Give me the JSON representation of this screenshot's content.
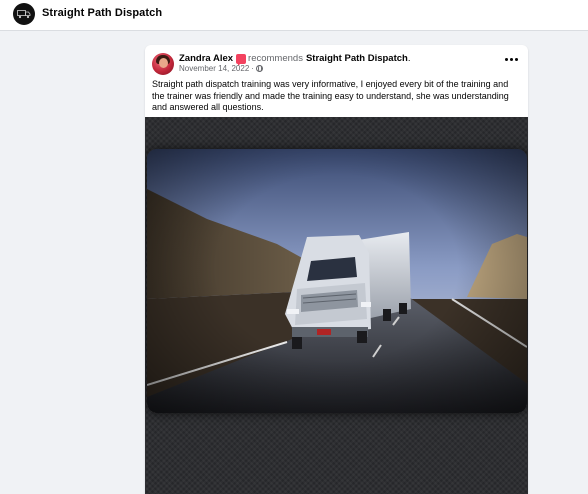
{
  "header": {
    "page_name": "Straight Path Dispatch",
    "logo_icon": "truck-logo-icon"
  },
  "post": {
    "author": "Zandra Alex",
    "recommend_icon": "recommend-flag-icon",
    "recommend_verb": "recommends",
    "recommended_page": "Straight Path Dispatch",
    "recommended_suffix": ".",
    "date": "November 14, 2022",
    "date_separator": "·",
    "privacy_icon": "globe-icon",
    "more_icon": "more-options-icon",
    "text": "Straight path dispatch training was very informative, I enjoyed every bit of the training and the trainer was friendly and made the training easy to understand, she was understanding and answered all questions.",
    "media_subject": "white semi truck driving on highway"
  },
  "colors": {
    "background": "#f0f2f5",
    "card": "#ffffff",
    "secondary_text": "#65676b",
    "recommend_red": "#f3425f",
    "media_frame": "#26272a"
  }
}
